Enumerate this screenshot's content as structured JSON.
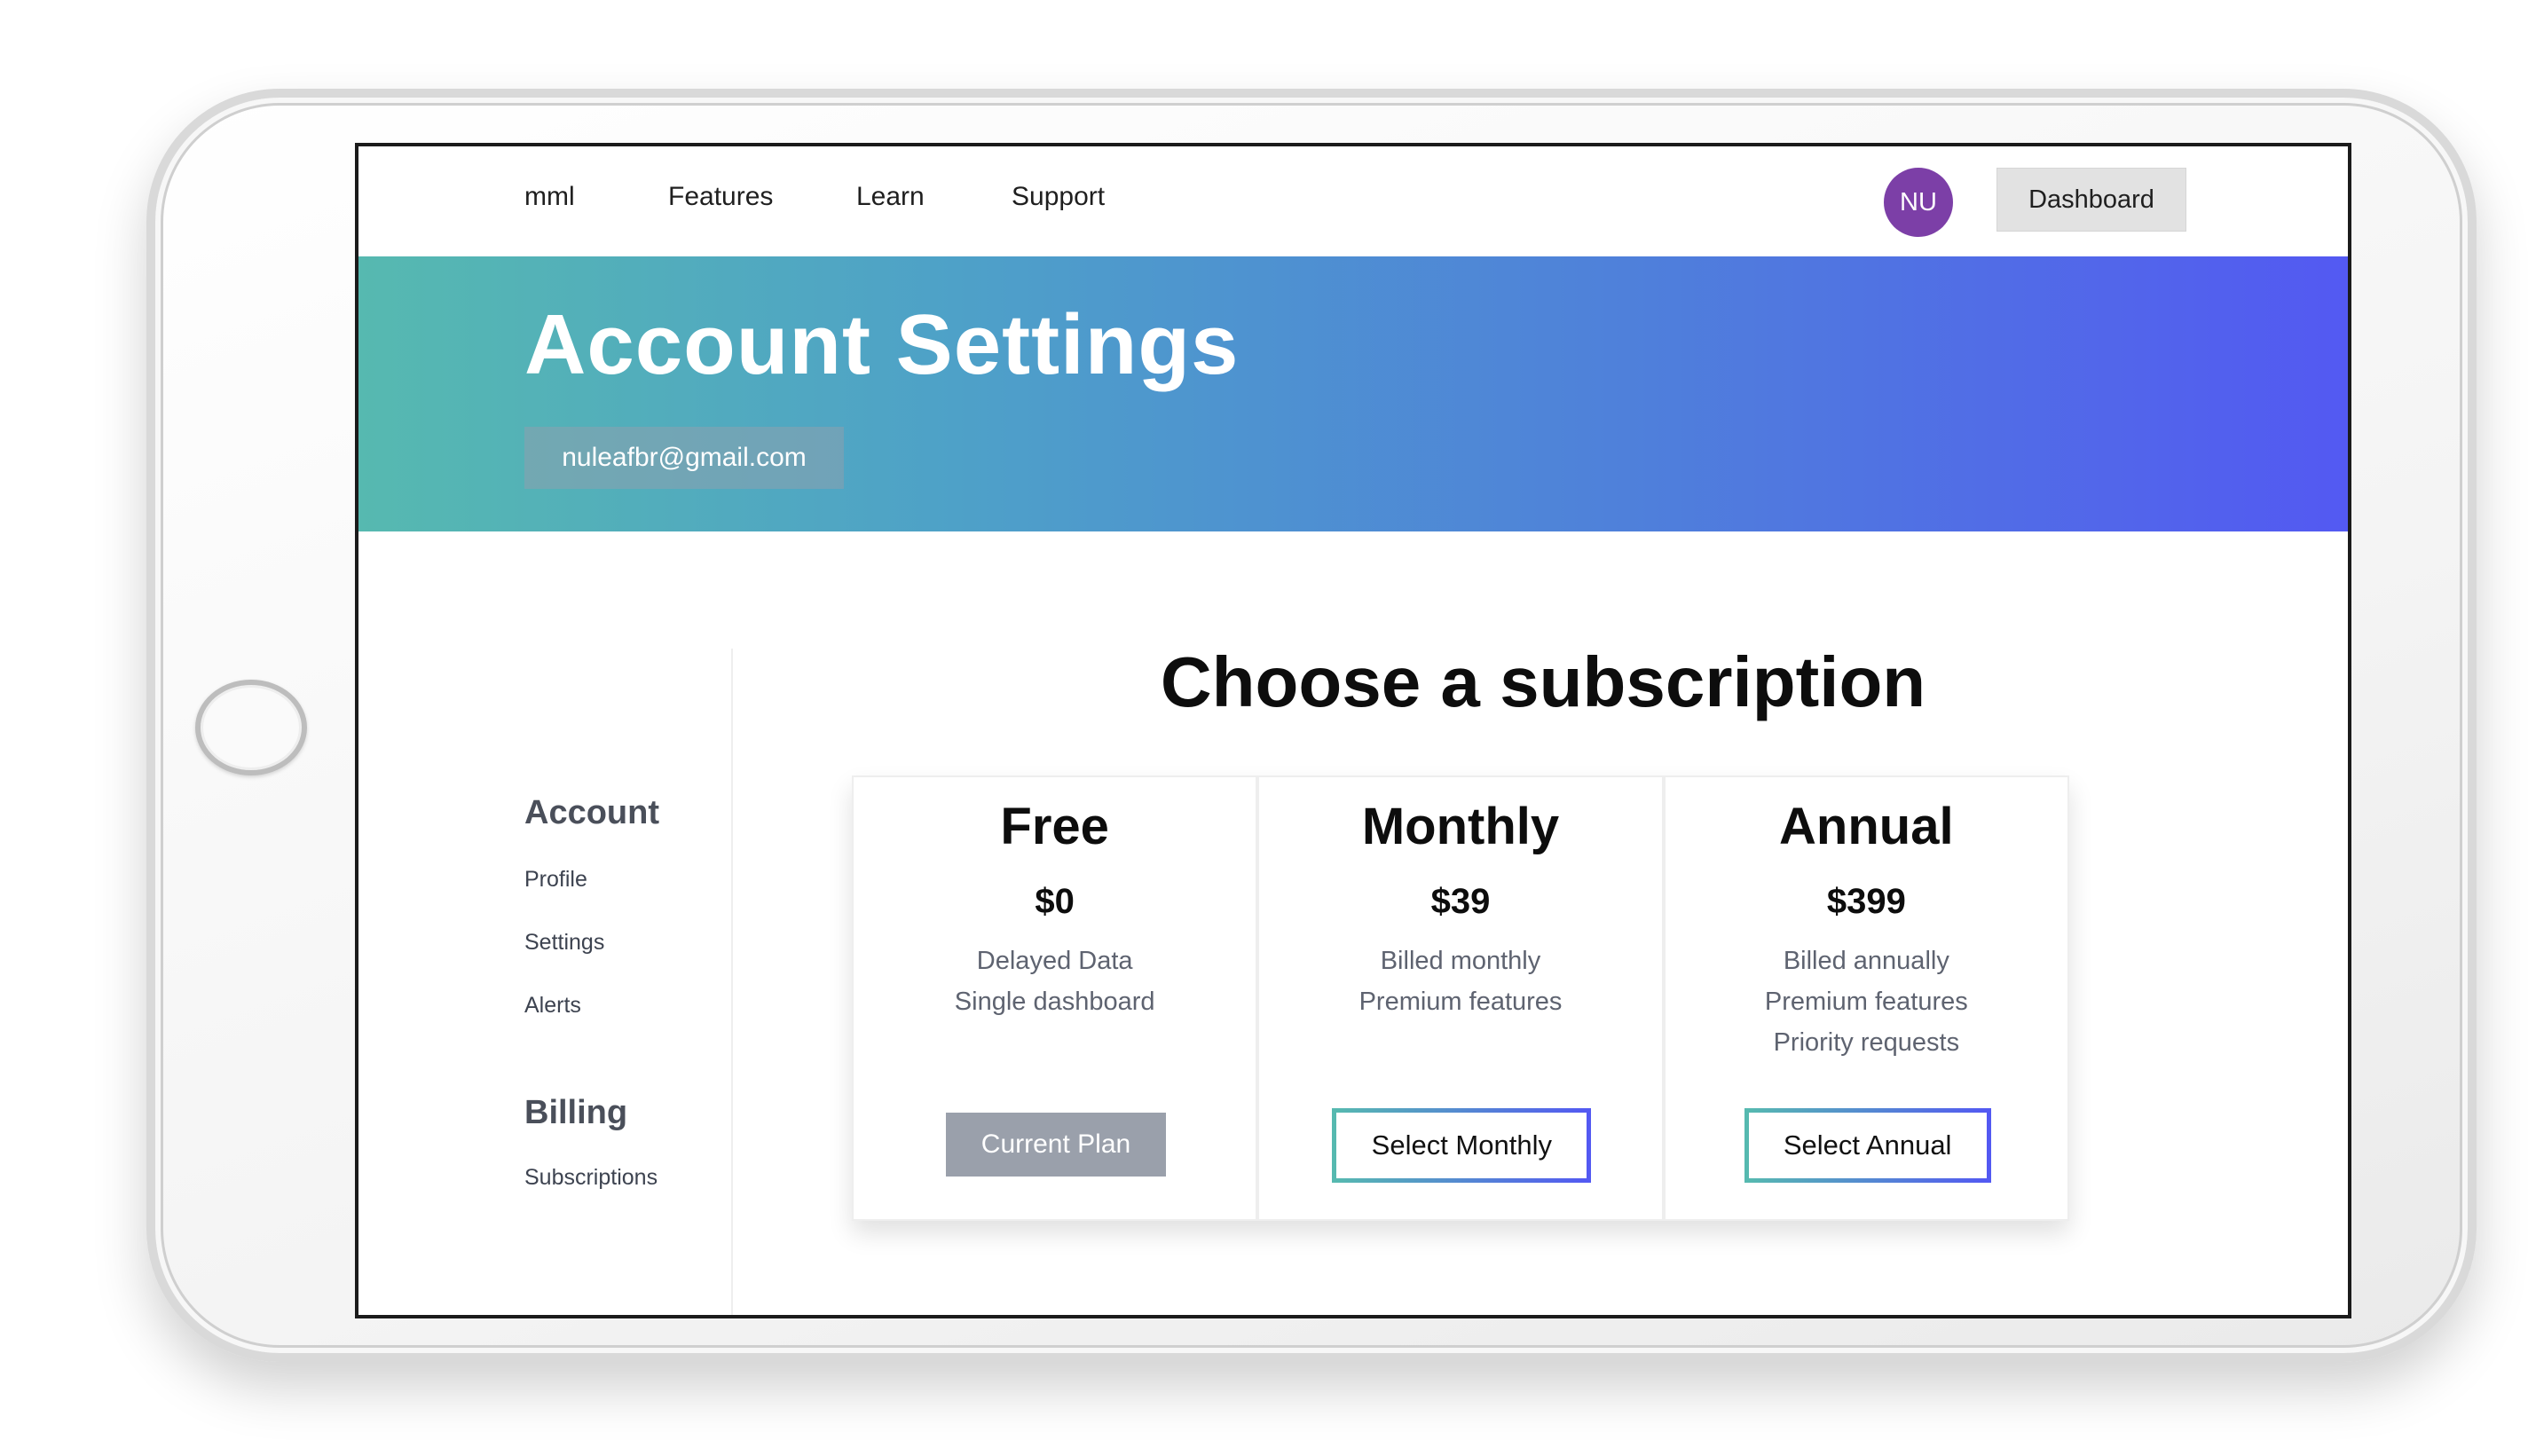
{
  "nav": {
    "brand": "mml",
    "links": [
      "Features",
      "Learn",
      "Support"
    ],
    "avatar_initials": "NU",
    "dashboard_label": "Dashboard"
  },
  "hero": {
    "title": "Account Settings",
    "email": "nuleafbr@gmail.com"
  },
  "sidebar": {
    "account_heading": "Account",
    "account_items": [
      "Profile",
      "Settings",
      "Alerts"
    ],
    "billing_heading": "Billing",
    "billing_items": [
      "Subscriptions"
    ]
  },
  "main": {
    "title": "Choose a subscription",
    "plans": [
      {
        "name": "Free",
        "price": "$0",
        "features": [
          "Delayed Data",
          "Single dashboard"
        ],
        "button_label": "Current Plan"
      },
      {
        "name": "Monthly",
        "price": "$39",
        "features": [
          "Billed monthly",
          "Premium features"
        ],
        "button_label": "Select Monthly"
      },
      {
        "name": "Annual",
        "price": "$399",
        "features": [
          "Billed annually",
          "Premium features",
          "Priority requests"
        ],
        "button_label": "Select Annual"
      }
    ]
  },
  "colors": {
    "hero_gradient_start": "#56b9b0",
    "hero_gradient_end": "#5359f2",
    "avatar": "#7c3fa7",
    "current_plan_button": "#9aa0ab"
  }
}
